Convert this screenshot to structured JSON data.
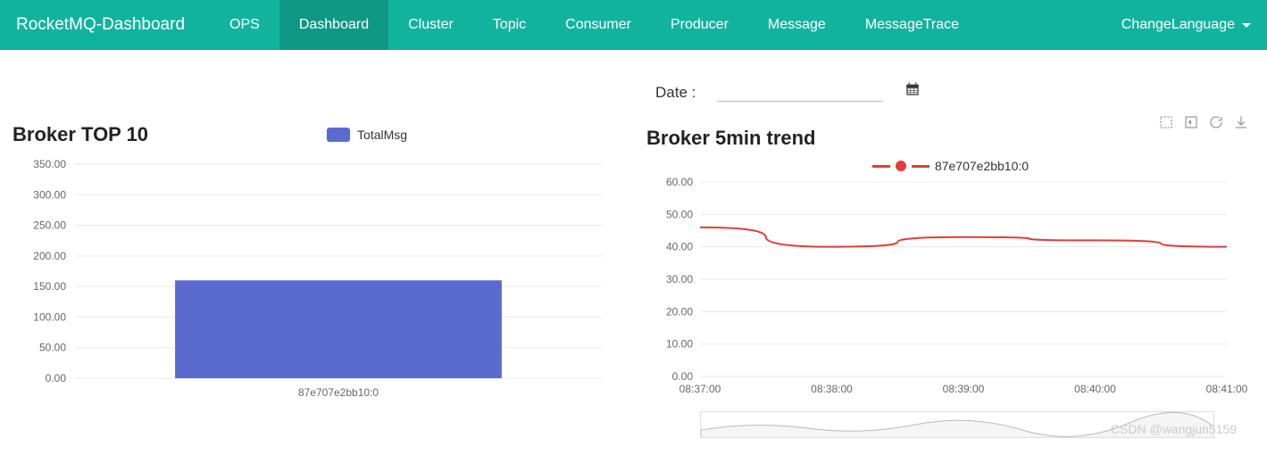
{
  "nav": {
    "brand": "RocketMQ-Dashboard",
    "items": [
      "OPS",
      "Dashboard",
      "Cluster",
      "Topic",
      "Consumer",
      "Producer",
      "Message",
      "MessageTrace"
    ],
    "active": 1,
    "lang": "ChangeLanguage"
  },
  "date": {
    "label": "Date :",
    "value": ""
  },
  "left": {
    "title": "Broker TOP 10",
    "legend": "TotalMsg",
    "legend_color": "#5a6acf"
  },
  "right": {
    "title": "Broker 5min trend",
    "legend": "87e707e2bb10:0",
    "legend_color": "#e43b3b"
  },
  "watermark": "CSDN @wangjun5159",
  "chart_data": [
    {
      "type": "bar",
      "title": "Broker TOP 10",
      "categories": [
        "87e707e2bb10:0"
      ],
      "series": [
        {
          "name": "TotalMsg",
          "values": [
            160
          ]
        }
      ],
      "ylabel": "",
      "xlabel": "",
      "ylim": [
        0,
        350
      ],
      "yticks": [
        0,
        50,
        100,
        150,
        200,
        250,
        300,
        350
      ],
      "grid": true
    },
    {
      "type": "line",
      "title": "Broker 5min trend",
      "x": [
        "08:37:00",
        "08:38:00",
        "08:39:00",
        "08:40:00",
        "08:41:00"
      ],
      "series": [
        {
          "name": "87e707e2bb10:0",
          "values": [
            46,
            40,
            43,
            42,
            40
          ]
        }
      ],
      "ylabel": "",
      "xlabel": "",
      "ylim": [
        0,
        60
      ],
      "yticks": [
        0,
        10,
        20,
        30,
        40,
        50,
        60
      ],
      "grid": true
    }
  ]
}
